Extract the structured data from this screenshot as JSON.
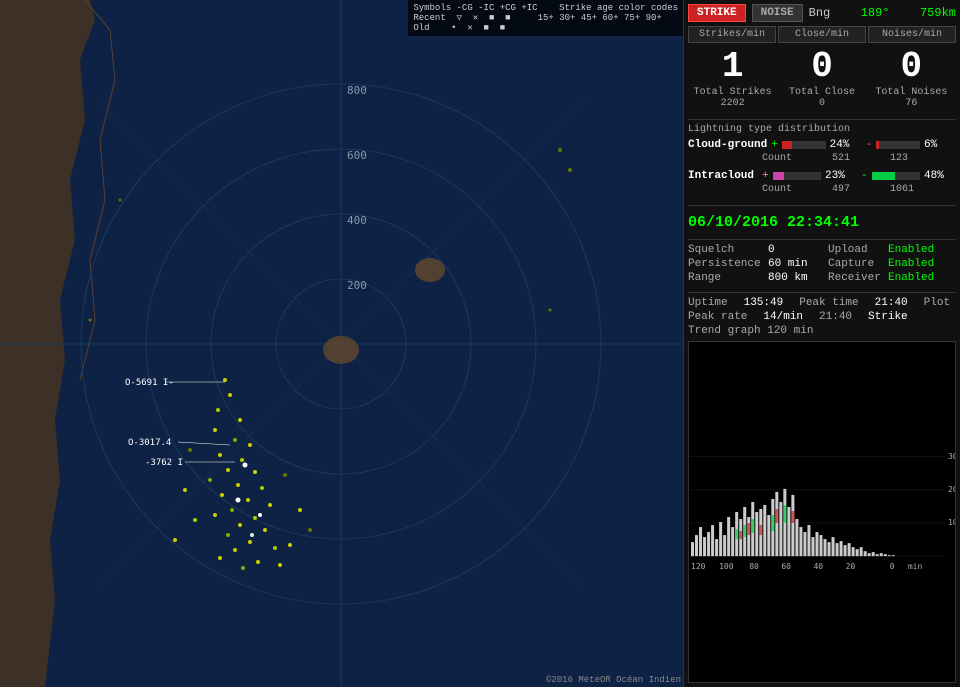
{
  "map": {
    "copyright": "©2016 MéteOR Océan Indien"
  },
  "legend": {
    "title": "Symbols -CG  -IC  +CG  +IC",
    "recent_label": "Recent",
    "old_label": "Old",
    "age_code_title": "Strike age color codes",
    "codes": "15+  30+  45+  60+  75+  90+"
  },
  "panel": {
    "btn_strike": "STRIKE",
    "btn_noise": "NOISE",
    "bng_label": "Bng",
    "bng_value": "189°",
    "bng_dist": "759km",
    "rate_labels": {
      "strikes": "Strikes/min",
      "close": "Close/min",
      "noises": "Noises/min"
    },
    "current_rates": {
      "strikes": "1",
      "close": "0",
      "noises": "0"
    },
    "totals": {
      "strikes_label": "Total Strikes",
      "strikes_count": "2202",
      "close_label": "Total Close",
      "close_count": "0",
      "noises_label": "Total Noises",
      "noises_count": "76"
    },
    "lightning_section": {
      "title": "Lightning type distribution",
      "cloud_ground_label": "Cloud-ground",
      "cg_plus_pct": "24%",
      "cg_minus_pct": "6%",
      "cg_plus_count": "521",
      "cg_minus_count": "123",
      "intracloud_label": "Intracloud",
      "ic_plus_pct": "23%",
      "ic_minus_pct": "48%",
      "ic_plus_count": "497",
      "ic_minus_count": "1061"
    },
    "timestamp": "06/10/2016 22:34:41",
    "squelch_label": "Squelch",
    "squelch_value": "0",
    "persistence_label": "Persistence",
    "persistence_value": "60 min",
    "range_label": "Range",
    "range_value": "800 km",
    "upload_label": "Upload",
    "upload_value": "Enabled",
    "capture_label": "Capture",
    "capture_value": "Enabled",
    "receiver_label": "Receiver",
    "receiver_value": "Enabled",
    "uptime_label": "Uptime",
    "uptime_value": "135:49",
    "peak_time_label": "Peak time",
    "peak_time_value": "21:40",
    "peak_rate_label": "Peak rate",
    "peak_rate_value": "14/min",
    "plot_label": "Plot",
    "plot_value": "Strike",
    "trend_label": "Trend graph",
    "trend_value": "120 min"
  },
  "distance_labels": [
    "800",
    "600",
    "400",
    "200"
  ],
  "chart_x_labels": [
    "120",
    "100",
    "80",
    "60",
    "40",
    "20",
    "0",
    "min"
  ]
}
